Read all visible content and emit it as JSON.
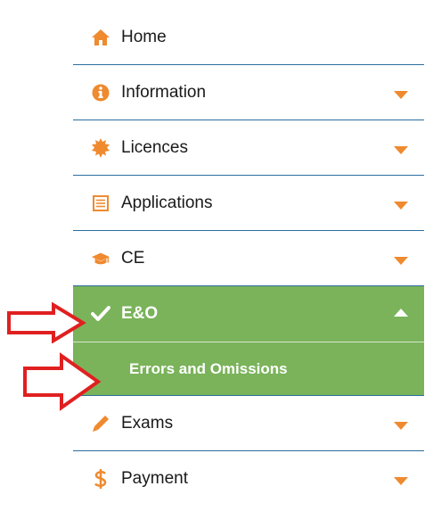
{
  "menu": {
    "items": [
      {
        "label": "Home",
        "icon": "home-icon"
      },
      {
        "label": "Information",
        "icon": "info-circle-icon"
      },
      {
        "label": "Licences",
        "icon": "badge-icon"
      },
      {
        "label": "Applications",
        "icon": "document-icon"
      },
      {
        "label": "CE",
        "icon": "graduation-cap-icon"
      },
      {
        "label": "E&O",
        "icon": "checkmark-icon",
        "active": true,
        "expanded": true
      },
      {
        "label": "Exams",
        "icon": "pencil-icon"
      },
      {
        "label": "Payment",
        "icon": "dollar-icon"
      }
    ],
    "sub_items": [
      {
        "label": "Errors and Omissions"
      }
    ]
  },
  "colors": {
    "accent": "#ef8a2f",
    "active_bg": "#7ab35a",
    "divider": "#2a6e9e",
    "annotation_arrow": "#e02020"
  },
  "annotations": [
    {
      "type": "arrow",
      "points_to": "E&O"
    },
    {
      "type": "arrow",
      "points_to": "Errors and Omissions"
    }
  ]
}
